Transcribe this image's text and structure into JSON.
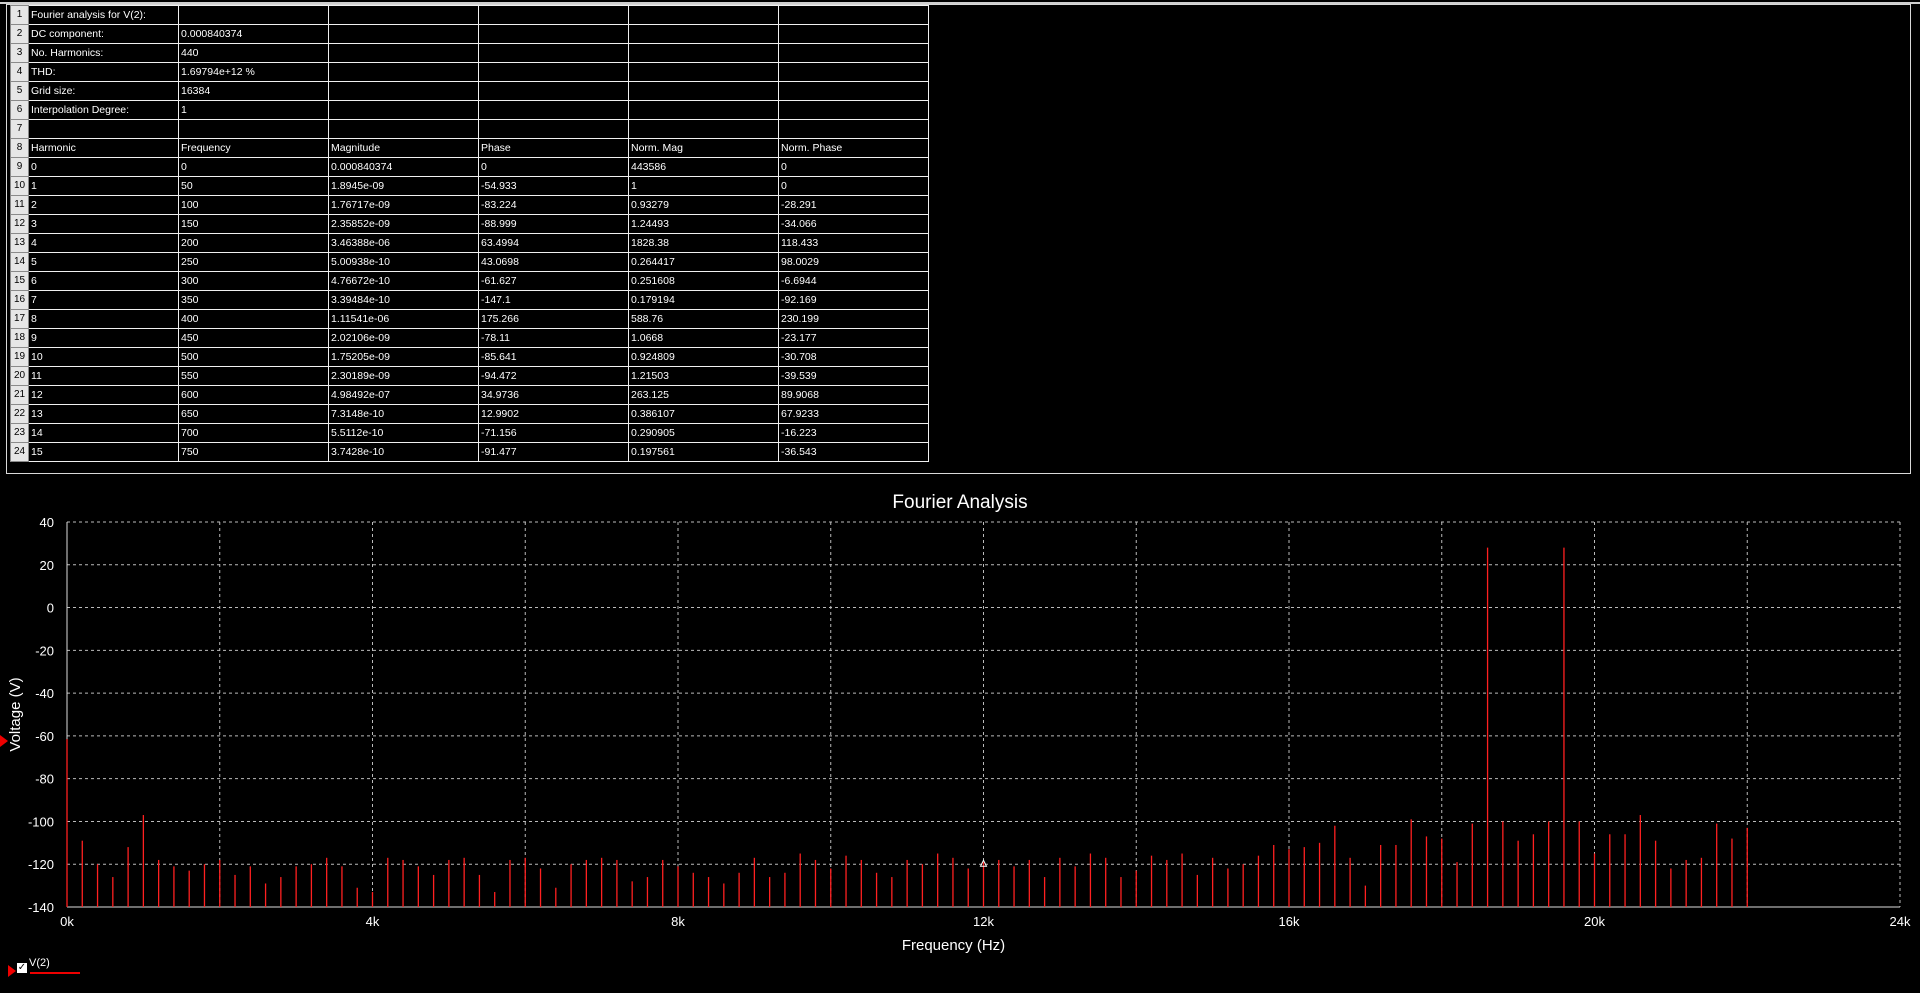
{
  "sheet": {
    "rows": [
      [
        "Fourier analysis for V(2):",
        "",
        "",
        "",
        "",
        ""
      ],
      [
        "DC component:",
        "0.000840374",
        "",
        "",
        "",
        ""
      ],
      [
        "No. Harmonics:",
        "440",
        "",
        "",
        "",
        ""
      ],
      [
        "THD:",
        "1.69794e+12 %",
        "",
        "",
        "",
        ""
      ],
      [
        "Grid size:",
        "16384",
        "",
        "",
        "",
        ""
      ],
      [
        "Interpolation Degree:",
        "1",
        "",
        "",
        "",
        ""
      ],
      [
        "",
        "",
        "",
        "",
        "",
        ""
      ],
      [
        "Harmonic",
        "Frequency",
        "Magnitude",
        "Phase",
        "Norm. Mag",
        "Norm. Phase"
      ],
      [
        "0",
        "0",
        "0.000840374",
        "0",
        "443586",
        "0"
      ],
      [
        "1",
        "50",
        "1.8945e-09",
        "-54.933",
        "1",
        "0"
      ],
      [
        "2",
        "100",
        "1.76717e-09",
        "-83.224",
        "0.93279",
        "-28.291"
      ],
      [
        "3",
        "150",
        "2.35852e-09",
        "-88.999",
        "1.24493",
        "-34.066"
      ],
      [
        "4",
        "200",
        "3.46388e-06",
        "63.4994",
        "1828.38",
        "118.433"
      ],
      [
        "5",
        "250",
        "5.00938e-10",
        "43.0698",
        "0.264417",
        "98.0029"
      ],
      [
        "6",
        "300",
        "4.76672e-10",
        "-61.627",
        "0.251608",
        "-6.6944"
      ],
      [
        "7",
        "350",
        "3.39484e-10",
        "-147.1",
        "0.179194",
        "-92.169"
      ],
      [
        "8",
        "400",
        "1.11541e-06",
        "175.266",
        "588.76",
        "230.199"
      ],
      [
        "9",
        "450",
        "2.02106e-09",
        "-78.11",
        "1.0668",
        "-23.177"
      ],
      [
        "10",
        "500",
        "1.75205e-09",
        "-85.641",
        "0.924809",
        "-30.708"
      ],
      [
        "11",
        "550",
        "2.30189e-09",
        "-94.472",
        "1.21503",
        "-39.539"
      ],
      [
        "12",
        "600",
        "4.98492e-07",
        "34.9736",
        "263.125",
        "89.9068"
      ],
      [
        "13",
        "650",
        "7.3148e-10",
        "12.9902",
        "0.386107",
        "67.9233"
      ],
      [
        "14",
        "700",
        "5.5112e-10",
        "-71.156",
        "0.290905",
        "-16.223"
      ],
      [
        "15",
        "750",
        "3.7428e-10",
        "-91.477",
        "0.197561",
        "-36.543"
      ]
    ]
  },
  "chart_data": {
    "type": "bar",
    "title": "Fourier Analysis",
    "xlabel": "Frequency (Hz)",
    "ylabel": "Voltage (V)",
    "xlim": [
      0,
      24000
    ],
    "ylim": [
      -140,
      40
    ],
    "x_ticks": [
      0,
      4000,
      8000,
      12000,
      16000,
      20000,
      24000
    ],
    "x_tick_labels": [
      "0k",
      "4k",
      "8k",
      "12k",
      "16k",
      "20k",
      "24k"
    ],
    "y_ticks": [
      40,
      20,
      0,
      -20,
      -40,
      -60,
      -80,
      -100,
      -120,
      -140
    ],
    "y_tick_labels": [
      "40",
      "20",
      "0",
      "-20",
      "-40",
      "-60",
      "-80",
      "-100",
      "-120",
      "-140"
    ],
    "grid": true,
    "series": [
      {
        "name": "V(2)",
        "color": "#ff2020",
        "x": [
          0,
          200,
          400,
          600,
          800,
          1000,
          1200,
          1400,
          1600,
          1800,
          2000,
          2200,
          2400,
          2600,
          2800,
          3000,
          3200,
          3400,
          3600,
          3800,
          4000,
          4200,
          4400,
          4600,
          4800,
          5000,
          5200,
          5400,
          5600,
          5800,
          6000,
          6200,
          6400,
          6600,
          6800,
          7000,
          7200,
          7400,
          7600,
          7800,
          8000,
          8200,
          8400,
          8600,
          8800,
          9000,
          9200,
          9400,
          9600,
          9800,
          10000,
          10200,
          10400,
          10600,
          10800,
          11000,
          11200,
          11400,
          11600,
          11800,
          12000,
          12200,
          12400,
          12600,
          12800,
          13000,
          13200,
          13400,
          13600,
          13800,
          14000,
          14200,
          14400,
          14600,
          14800,
          15000,
          15200,
          15400,
          15600,
          15800,
          16000,
          16200,
          16400,
          16600,
          16800,
          17000,
          17200,
          17400,
          17600,
          17800,
          18000,
          18200,
          18400,
          18600,
          18800,
          19000,
          19200,
          19400,
          19600,
          19800,
          20000,
          20200,
          20400,
          20600,
          20800,
          21000,
          21200,
          21400,
          21600,
          21800,
          22000
        ],
        "values": [
          -61.5,
          -109,
          -120,
          -126,
          -112,
          -97,
          -118,
          -121,
          -123,
          -120,
          -118,
          -125,
          -121,
          -129,
          -126,
          -121,
          -120,
          -117,
          -121,
          -131,
          -133,
          -117,
          -118,
          -121,
          -125,
          -118,
          -117,
          -125,
          -133,
          -118,
          -117,
          -122,
          -131,
          -120,
          -118,
          -117,
          -118,
          -128,
          -126,
          -118,
          -121,
          -124,
          -126,
          -129,
          -124,
          -117,
          -126,
          -124,
          -115,
          -118,
          -122,
          -116,
          -118,
          -124,
          -126,
          -118,
          -120,
          -115,
          -117,
          -122,
          -119,
          -118,
          -121,
          -118,
          -126,
          -117,
          -121,
          -115,
          -117,
          -126,
          -123,
          -116,
          -118,
          -115,
          -125,
          -117,
          -122,
          -120,
          -116,
          -111,
          -113,
          -112,
          -110,
          -102,
          -117,
          -130,
          -111,
          -111,
          -99,
          -107,
          -108,
          -119,
          -101,
          28,
          -100,
          -109,
          -106,
          -100,
          28,
          -100,
          -115,
          -106,
          -106,
          -97,
          -109,
          -122,
          -118,
          -117,
          -101,
          -108,
          -103
        ]
      }
    ]
  },
  "legend": {
    "label": "V(2)",
    "checked": "✓"
  }
}
